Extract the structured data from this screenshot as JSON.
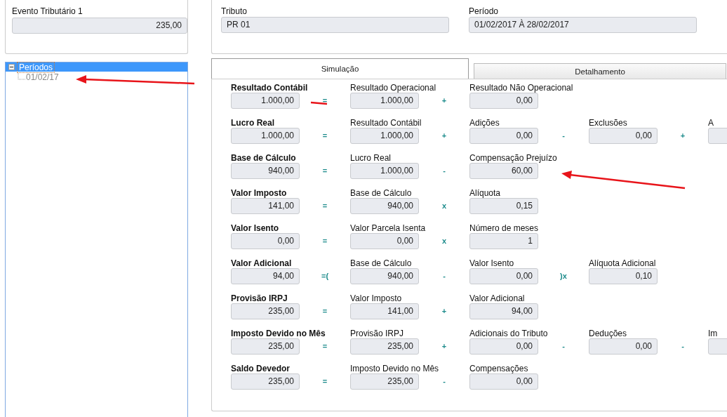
{
  "event_field": {
    "label": "Evento Tributário 1",
    "value": "235,00"
  },
  "tree": [
    {
      "label": "Períodos",
      "expanded": true,
      "selected": true,
      "children": [
        {
          "label": "01/02/17",
          "selected": false
        }
      ]
    }
  ],
  "header_fields": [
    {
      "label": "Tributo",
      "value": "PR 01"
    },
    {
      "label": "Período",
      "value": "01/02/2017 À 28/02/2017"
    }
  ],
  "tabs": [
    {
      "label": "Simulação",
      "selected": true
    },
    {
      "label": "Detalhamento",
      "selected": false
    }
  ],
  "rows": [
    {
      "label": "Resultado Contábil",
      "value": "1.000,00",
      "terms": [
        {
          "op": "=",
          "label": "Resultado Operacional",
          "value": "1.000,00"
        },
        {
          "op": "+",
          "label": "Resultado Não Operacional",
          "value": "0,00"
        }
      ]
    },
    {
      "label": "Lucro Real",
      "value": "1.000,00",
      "terms": [
        {
          "op": "=",
          "label": "Resultado Contábil",
          "value": "1.000,00"
        },
        {
          "op": "+",
          "label": "Adições",
          "value": "0,00"
        },
        {
          "op": "-",
          "label": "Exclusões",
          "value": "0,00"
        },
        {
          "op": "+",
          "label": "A"
        }
      ]
    },
    {
      "label": "Base de Cálculo",
      "value": "940,00",
      "terms": [
        {
          "op": "=",
          "label": "Lucro Real",
          "value": "1.000,00"
        },
        {
          "op": "-",
          "label": "Compensação Prejuízo",
          "value": "60,00"
        }
      ]
    },
    {
      "label": "Valor Imposto",
      "value": "141,00",
      "terms": [
        {
          "op": "=",
          "label": "Base de Cálculo",
          "value": "940,00"
        },
        {
          "op": "x",
          "label": "Alíquota",
          "value": "0,15"
        }
      ]
    },
    {
      "label": "Valor Isento",
      "value": "0,00",
      "terms": [
        {
          "op": "=",
          "label": "Valor Parcela Isenta",
          "value": "0,00"
        },
        {
          "op": "x",
          "label": "Número de meses",
          "value": "1"
        }
      ]
    },
    {
      "label": "Valor Adicional",
      "value": "94,00",
      "terms": [
        {
          "op": "=(",
          "label": "Base de Cálculo",
          "value": "940,00"
        },
        {
          "op": "-",
          "label": "Valor Isento",
          "value": "0,00"
        },
        {
          "op": ")x",
          "label": "Alíquota Adicional",
          "value": "0,10"
        }
      ]
    },
    {
      "label": "Provisão IRPJ",
      "value": "235,00",
      "terms": [
        {
          "op": "=",
          "label": "Valor Imposto",
          "value": "141,00"
        },
        {
          "op": "+",
          "label": "Valor Adicional",
          "value": "94,00"
        }
      ]
    },
    {
      "label": "Imposto Devido no Mês",
      "value": "235,00",
      "terms": [
        {
          "op": "=",
          "label": "Provisão IRPJ",
          "value": "235,00"
        },
        {
          "op": "+",
          "label": "Adicionais do Tributo",
          "value": "0,00"
        },
        {
          "op": "-",
          "label": "Deduções",
          "value": "0,00"
        },
        {
          "op": "-",
          "label": "Im"
        }
      ]
    },
    {
      "label": "Saldo Devedor",
      "value": "235,00",
      "terms": [
        {
          "op": "=",
          "label": "Imposto Devido no Mês",
          "value": "235,00"
        },
        {
          "op": "-",
          "label": "Compensações",
          "value": "0,00"
        }
      ]
    }
  ]
}
